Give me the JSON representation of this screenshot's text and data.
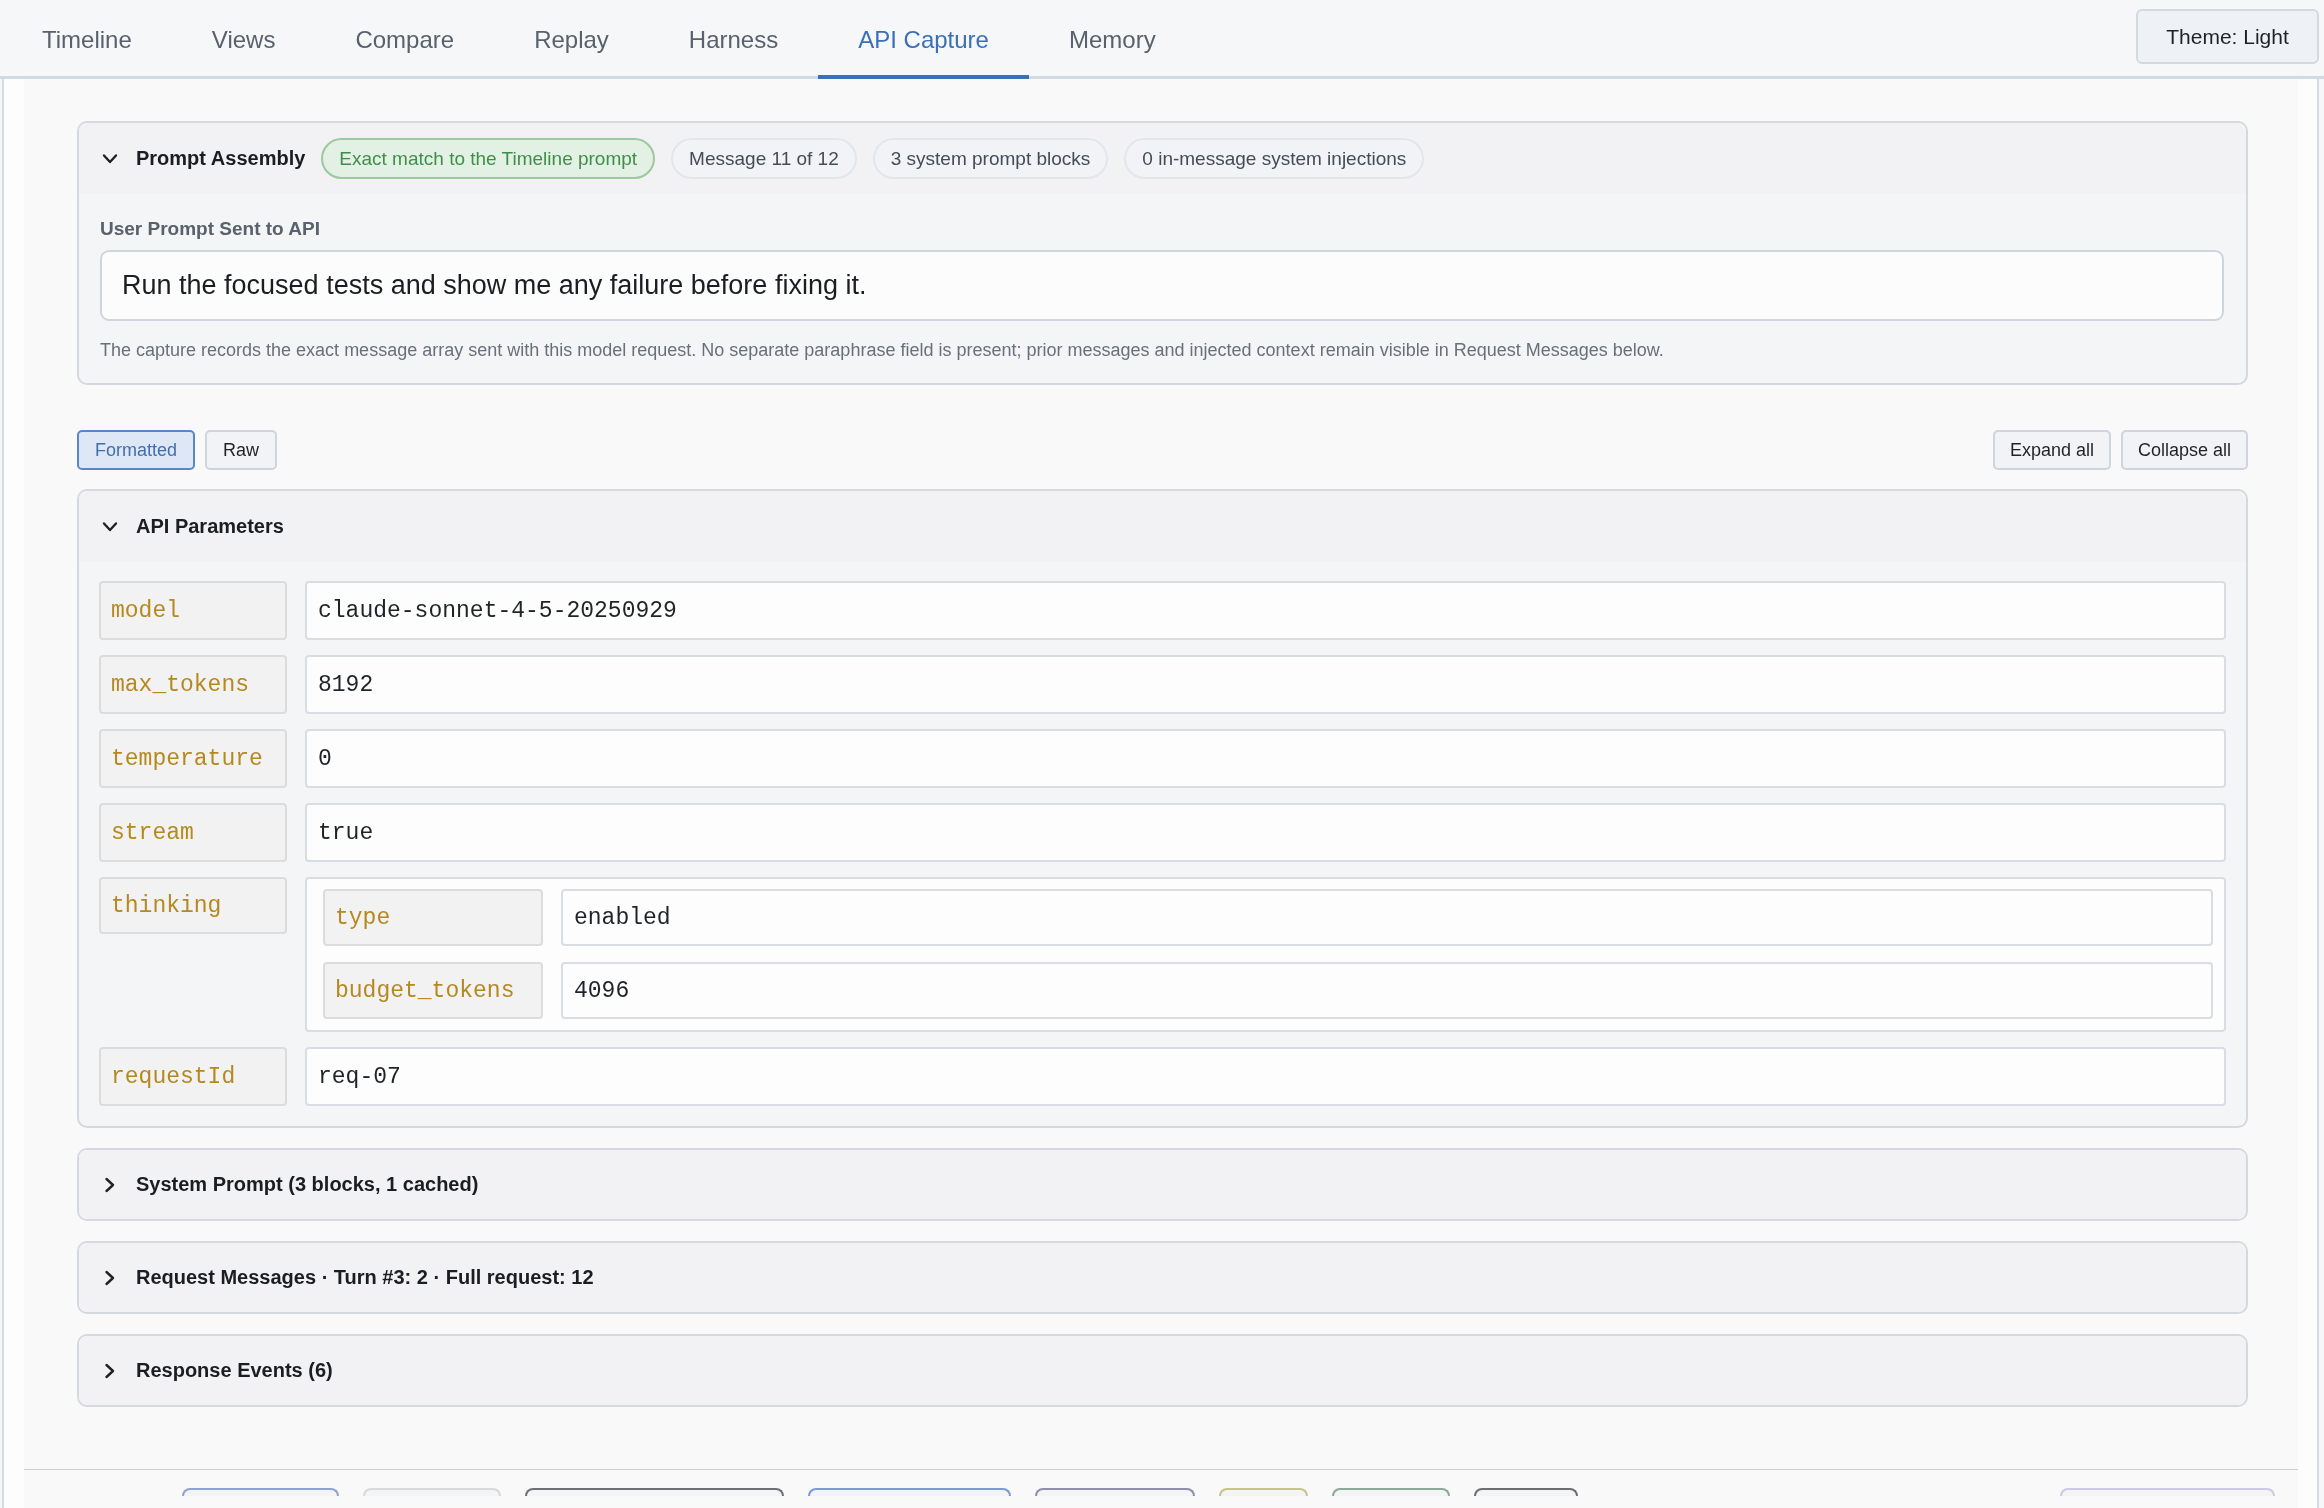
{
  "tabs": [
    {
      "label": "Timeline",
      "selected": false
    },
    {
      "label": "Views",
      "selected": false
    },
    {
      "label": "Compare",
      "selected": false
    },
    {
      "label": "Replay",
      "selected": false
    },
    {
      "label": "Harness",
      "selected": false
    },
    {
      "label": "API Capture",
      "selected": true
    },
    {
      "label": "Memory",
      "selected": false
    }
  ],
  "theme_button": "Theme: Light",
  "prompt_assembly": {
    "title": "Prompt Assembly",
    "expanded": true,
    "badges": [
      {
        "label": "Exact match to the Timeline prompt",
        "kind": "match"
      },
      {
        "label": "Message 11 of 12",
        "kind": "info"
      },
      {
        "label": "3 system prompt blocks",
        "kind": "info"
      },
      {
        "label": "0 in-message system injections",
        "kind": "info"
      }
    ],
    "prompt_label": "User Prompt Sent to API",
    "prompt_value": "Run the focused tests and show me any failure before fixing it.",
    "note": "The capture records the exact message array sent with this model request. No separate paraphrase field is present; prior messages and injected context remain visible in Request Messages below."
  },
  "view_modes": [
    {
      "label": "Formatted",
      "selected": true
    },
    {
      "label": "Raw",
      "selected": false
    }
  ],
  "actions": [
    "Expand all",
    "Collapse all"
  ],
  "sections": [
    {
      "title": "API Parameters",
      "expanded": true,
      "params": [
        {
          "kind": "value",
          "key": "model",
          "value": "claude-sonnet-4-5-20250929"
        },
        {
          "kind": "value",
          "key": "max_tokens",
          "value": "8192"
        },
        {
          "kind": "value",
          "key": "temperature",
          "value": "0"
        },
        {
          "kind": "value",
          "key": "stream",
          "value": "true"
        },
        {
          "kind": "object",
          "key": "thinking",
          "children": [
            {
              "kind": "value",
              "key": "type",
              "value": "enabled"
            },
            {
              "kind": "value",
              "key": "budget_tokens",
              "value": "4096"
            }
          ]
        },
        {
          "kind": "value",
          "key": "requestId",
          "value": "req-07"
        }
      ]
    },
    {
      "title": "System Prompt (3 blocks, 1 cached)",
      "expanded": false
    },
    {
      "title": "Request Messages · Turn #3: 2 · Full request: 12",
      "expanded": false
    },
    {
      "title": "Response Events (6)",
      "expanded": false
    }
  ],
  "footer_buttons": [
    {
      "color": "#8fa3cf"
    },
    {
      "color": "#d9d9d9"
    },
    {
      "color": "#6f6f7a"
    },
    {
      "color": "#7d9bd0"
    },
    {
      "color": "#8f8fa6"
    },
    {
      "color": "#c9c48a"
    },
    {
      "color": "#8fa898"
    },
    {
      "color": "#6e6e70"
    },
    {
      "color": "#cfc8e3"
    }
  ]
}
